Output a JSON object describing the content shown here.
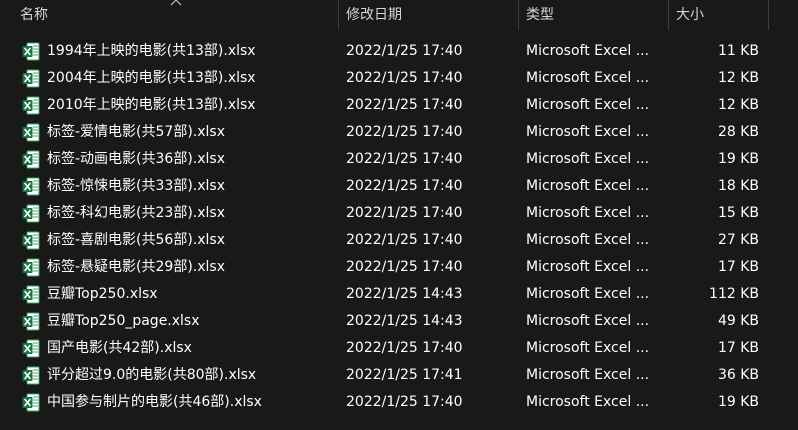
{
  "columns": {
    "name": "名称",
    "date": "修改日期",
    "type": "类型",
    "size": "大小"
  },
  "sort_indicator_icon": "chevron-up-icon",
  "file_icon": "excel-file-icon",
  "accent": {
    "excel_green": "#1e7145",
    "excel_green_light": "#33a867",
    "excel_sheet": "#ffffff"
  },
  "files": [
    {
      "name": "1994年上映的电影(共13部).xlsx",
      "date": "2022/1/25 17:40",
      "type": "Microsoft Excel ...",
      "size": "11 KB"
    },
    {
      "name": "2004年上映的电影(共13部).xlsx",
      "date": "2022/1/25 17:40",
      "type": "Microsoft Excel ...",
      "size": "12 KB"
    },
    {
      "name": "2010年上映的电影(共13部).xlsx",
      "date": "2022/1/25 17:40",
      "type": "Microsoft Excel ...",
      "size": "12 KB"
    },
    {
      "name": "标签-爱情电影(共57部).xlsx",
      "date": "2022/1/25 17:40",
      "type": "Microsoft Excel ...",
      "size": "28 KB"
    },
    {
      "name": "标签-动画电影(共36部).xlsx",
      "date": "2022/1/25 17:40",
      "type": "Microsoft Excel ...",
      "size": "19 KB"
    },
    {
      "name": "标签-惊悚电影(共33部).xlsx",
      "date": "2022/1/25 17:40",
      "type": "Microsoft Excel ...",
      "size": "18 KB"
    },
    {
      "name": "标签-科幻电影(共23部).xlsx",
      "date": "2022/1/25 17:40",
      "type": "Microsoft Excel ...",
      "size": "15 KB"
    },
    {
      "name": "标签-喜剧电影(共56部).xlsx",
      "date": "2022/1/25 17:40",
      "type": "Microsoft Excel ...",
      "size": "27 KB"
    },
    {
      "name": "标签-悬疑电影(共29部).xlsx",
      "date": "2022/1/25 17:40",
      "type": "Microsoft Excel ...",
      "size": "17 KB"
    },
    {
      "name": "豆瓣Top250.xlsx",
      "date": "2022/1/25 14:43",
      "type": "Microsoft Excel ...",
      "size": "112 KB"
    },
    {
      "name": "豆瓣Top250_page.xlsx",
      "date": "2022/1/25 14:43",
      "type": "Microsoft Excel ...",
      "size": "49 KB"
    },
    {
      "name": "国产电影(共42部).xlsx",
      "date": "2022/1/25 17:40",
      "type": "Microsoft Excel ...",
      "size": "17 KB"
    },
    {
      "name": "评分超过9.0的电影(共80部).xlsx",
      "date": "2022/1/25 17:41",
      "type": "Microsoft Excel ...",
      "size": "36 KB"
    },
    {
      "name": "中国参与制片的电影(共46部).xlsx",
      "date": "2022/1/25 17:40",
      "type": "Microsoft Excel ...",
      "size": "19 KB"
    }
  ]
}
